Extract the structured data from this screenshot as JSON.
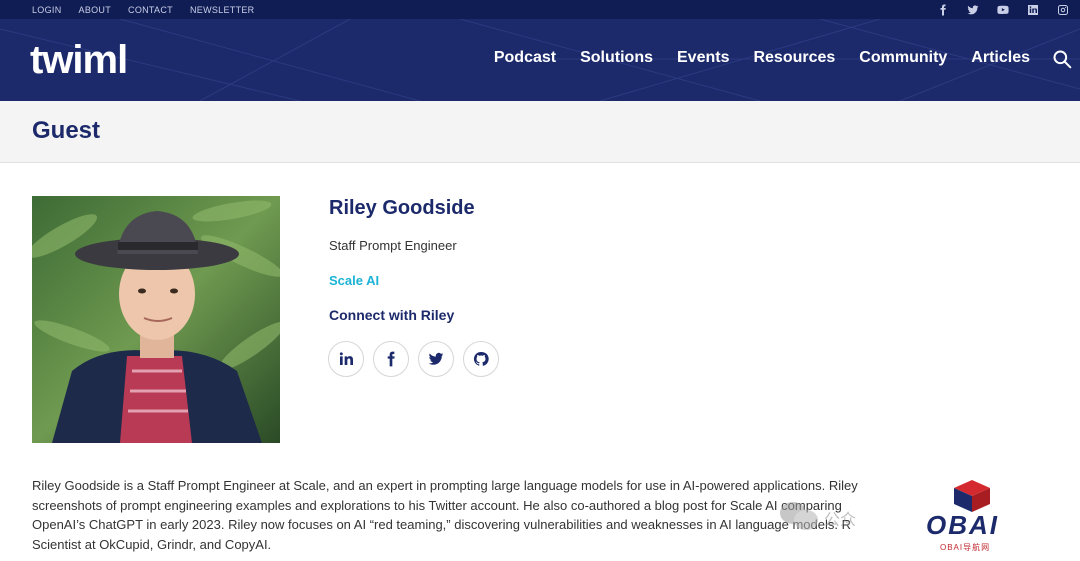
{
  "topbar": {
    "links": [
      "LOGIN",
      "ABOUT",
      "CONTACT",
      "NEWSLETTER"
    ],
    "social_icons": [
      "facebook-icon",
      "twitter-icon",
      "youtube-icon",
      "linkedin-icon",
      "instagram-icon"
    ]
  },
  "header": {
    "logo": "twiml",
    "nav": [
      "Podcast",
      "Solutions",
      "Events",
      "Resources",
      "Community",
      "Articles"
    ],
    "search_icon": "search-icon"
  },
  "page": {
    "title": "Guest"
  },
  "profile": {
    "name": "Riley Goodside",
    "role": "Staff Prompt Engineer",
    "company": "Scale AI",
    "connect_label": "Connect with Riley",
    "social": [
      "linkedin-icon",
      "facebook-icon",
      "twitter-icon",
      "github-icon"
    ]
  },
  "bio": {
    "lines": [
      "Riley Goodside is a Staff Prompt Engineer at Scale, and an expert in prompting large language models for use in AI-powered applications. Riley",
      "screenshots of prompt engineering examples and explorations to his Twitter account. He also co-authored a blog post for Scale AI comparing",
      "OpenAI’s ChatGPT in early 2023. Riley now focuses on AI “red teaming,” discovering vulnerabilities and weaknesses in AI language models. R",
      "Scientist at OkCupid, Grindr, and CopyAI."
    ]
  },
  "watermarks": {
    "wechat_text": "公众",
    "obai_logo": "OBAI",
    "obai_caption": "OBAI导航网"
  },
  "colors": {
    "navy": "#1c2a6b",
    "topbar": "#101d55",
    "accent": "#1bb3d6"
  }
}
